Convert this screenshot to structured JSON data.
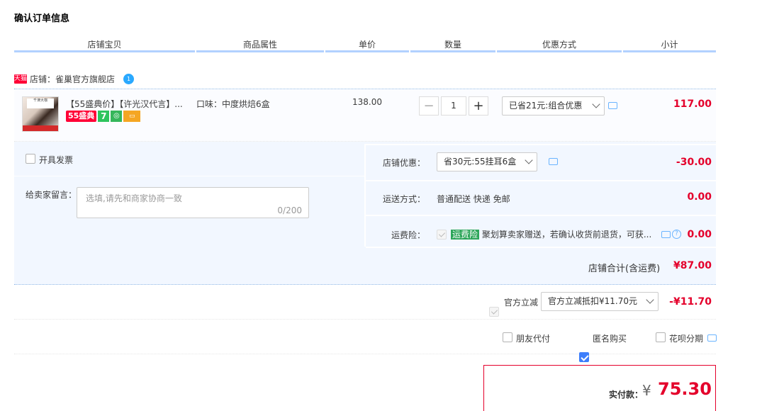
{
  "page_title": "确认订单信息",
  "columns": [
    "店铺宝贝",
    "商品属性",
    "单价",
    "数量",
    "优惠方式",
    "小计"
  ],
  "shop": {
    "badge": "天猫",
    "name": "店铺：雀巢官方旗舰店",
    "ww_badge": "1"
  },
  "item": {
    "thumb_text": "千津大咖",
    "title": "【55盛典价】【许光汉代言】...",
    "sale_badge": "55盛典",
    "badge_7": "7",
    "attr": "口味：中度烘焙6盒",
    "price": "138.00",
    "qty_minus": "−",
    "qty": "1",
    "qty_plus": "+",
    "promo": "已省21元:组合优惠",
    "subtotal": "117.00"
  },
  "invoice": {
    "label": "开具发票"
  },
  "memo": {
    "label": "给卖家留言：",
    "placeholder": "选填,请先和商家协商一致",
    "count": "0/200"
  },
  "shop_discount": {
    "label": "店铺优惠：",
    "value": "省30元:55挂耳6盒",
    "amount": "-30.00"
  },
  "shipping": {
    "label": "运送方式：",
    "value": "普通配送 快递 免邮",
    "amount": "0.00"
  },
  "insurance": {
    "label": "运费险：",
    "tag": "运费险",
    "text": "聚划算卖家赠送，若确认收货前退货，可获...",
    "help": "?",
    "amount": "0.00"
  },
  "shop_total": {
    "label": "店铺合计(含运费)",
    "amount": "¥87.00"
  },
  "official_discount": {
    "label": "官方立减",
    "value": "官方立减抵扣¥11.70元",
    "amount": "-¥11.70"
  },
  "options": {
    "friend_pay": "朋友代付",
    "anonymous": "匿名购买",
    "huabei": "花呗分期"
  },
  "payment": {
    "label": "实付款：",
    "currency": "¥",
    "amount": "75.30"
  },
  "colors": {
    "accent_red": "#e4002b",
    "header_line": "#b2d1ff",
    "panel_bg": "#f2f7ff",
    "checkbox_blue": "#3d7efb"
  }
}
